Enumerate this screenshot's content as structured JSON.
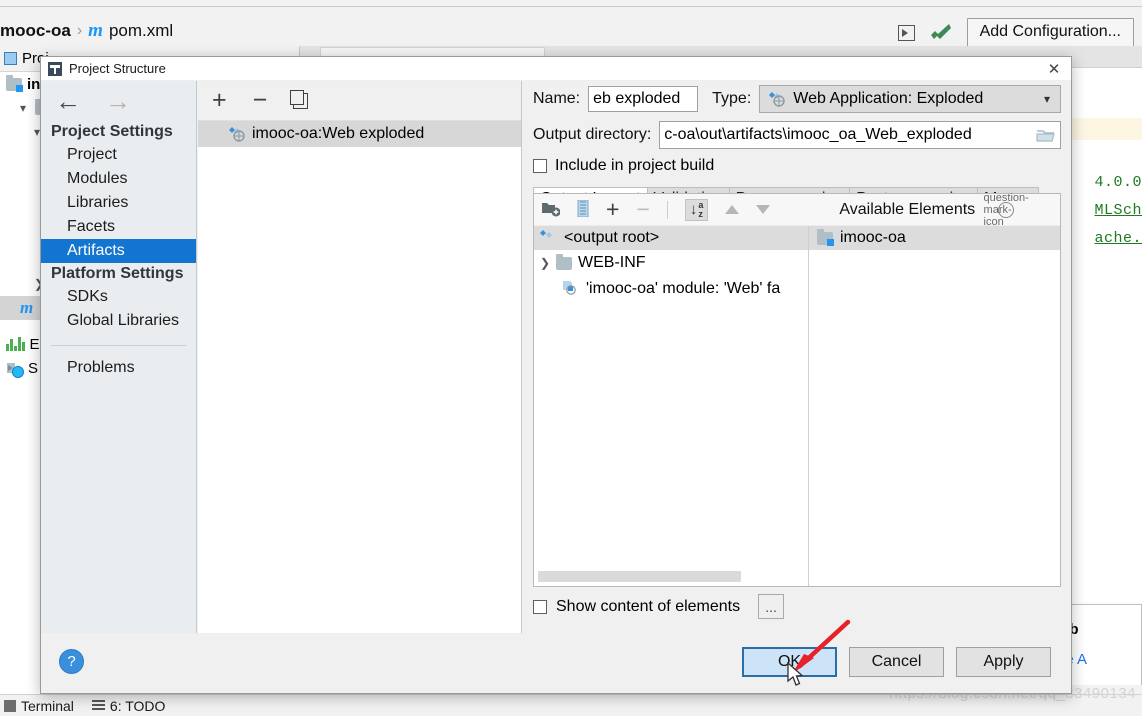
{
  "ide": {
    "breadcrumb": {
      "module": "mooc-oa",
      "separator": "›",
      "file_icon": "m",
      "file": "pom.xml"
    },
    "toolbar": {
      "run_icon": "run-configuration-icon",
      "build_icon": "hammer-icon",
      "add_configuration": "Add Configuration..."
    },
    "tool_window": {
      "title": "Proj",
      "items": [
        {
          "label": "in",
          "icon": "folder-module-icon"
        },
        {
          "label": "",
          "icon": "folder-icon"
        },
        {
          "label": "",
          "icon": "chevron-down-icon"
        },
        {
          "label": "",
          "icon": "chevron-right-icon"
        },
        {
          "label": "m",
          "icon": "maven-file-icon"
        }
      ],
      "bottom_items": [
        {
          "label": "E",
          "icon": "bar-chart-icon"
        },
        {
          "label": "S",
          "icon": "schedule-icon"
        }
      ]
    },
    "editor": {
      "code_lines": [
        "4.0.0",
        "MLSch",
        "ache."
      ]
    },
    "popup": {
      "line1": "eed to b",
      "link": "Enable A"
    },
    "status_bar": {
      "terminal": "Terminal",
      "todo": "6: TODO"
    },
    "watermark": "https://blog.csdn.net/qq_33490134"
  },
  "dialog": {
    "title": "Project Structure",
    "close_label": "✕",
    "nav": {
      "back_icon": "arrow-left-icon",
      "forward_icon": "arrow-right-icon",
      "groups": [
        {
          "title": "Project Settings",
          "items": [
            {
              "label": "Project",
              "selected": false
            },
            {
              "label": "Modules",
              "selected": false
            },
            {
              "label": "Libraries",
              "selected": false
            },
            {
              "label": "Facets",
              "selected": false
            },
            {
              "label": "Artifacts",
              "selected": true
            }
          ]
        },
        {
          "title": "Platform Settings",
          "items": [
            {
              "label": "SDKs",
              "selected": false
            },
            {
              "label": "Global Libraries",
              "selected": false
            }
          ]
        }
      ],
      "problems": "Problems"
    },
    "artifact_list": {
      "toolbar": {
        "add": "+",
        "remove": "−",
        "copy_icon": "copy-icon"
      },
      "items": [
        {
          "label": "imooc-oa:Web exploded",
          "icon": "web-exploded-artifact-icon",
          "selected": true
        }
      ]
    },
    "detail": {
      "name_label": "Name:",
      "name_value": "eb exploded",
      "type_label": "Type:",
      "type_value": "Web Application: Exploded",
      "type_icon": "web-exploded-artifact-icon",
      "output_dir_label": "Output directory:",
      "output_dir_value": "c-oa\\out\\artifacts\\imooc_oa_Web_exploded",
      "browse_icon": "folder-browse-icon",
      "include_build_label": "Include in project build",
      "include_build_checked": false,
      "tabs": [
        {
          "label": "Output Layout",
          "active": true
        },
        {
          "label": "Validation",
          "active": false
        },
        {
          "label": "Pre-processing",
          "active": false
        },
        {
          "label": "Post-processing",
          "active": false
        },
        {
          "label": "Maven",
          "active": false
        }
      ],
      "layout_toolbar": {
        "add_dir_icon": "new-folder-icon",
        "archive_icon": "archive-icon",
        "add_icon": "plus-dropdown-icon",
        "remove_icon": "minus-icon",
        "sort_icon": "sort-alpha-icon",
        "move_up_icon": "arrow-up-icon",
        "move_down_icon": "arrow-down-icon"
      },
      "available_elements_label": "Available Elements",
      "help_icon": "question-mark-icon",
      "output_tree": {
        "root": {
          "label": "<output root>",
          "icon": "artifact-root-icon"
        },
        "children": [
          {
            "label": "WEB-INF",
            "icon": "folder-icon",
            "expander": "❯"
          },
          {
            "label": "'imooc-oa' module: 'Web' fa",
            "icon": "web-facet-icon",
            "expander": ""
          }
        ]
      },
      "available_tree": {
        "items": [
          {
            "label": "imooc-oa",
            "icon": "module-folder-icon"
          }
        ]
      },
      "show_content_label": "Show content of elements",
      "show_content_checked": false,
      "more_button": "..."
    },
    "footer": {
      "help": "?",
      "ok": "OK",
      "cancel": "Cancel",
      "apply": "Apply"
    }
  },
  "annotation": {
    "arrow_color": "#e8202a",
    "arrow_name": "red-annotation-arrow",
    "cursor_name": "mouse-cursor"
  },
  "colors": {
    "accent": "#1375cf",
    "default_button": "#cde3f7",
    "code_green": "#1f7a1f",
    "link": "#1a73e8"
  }
}
